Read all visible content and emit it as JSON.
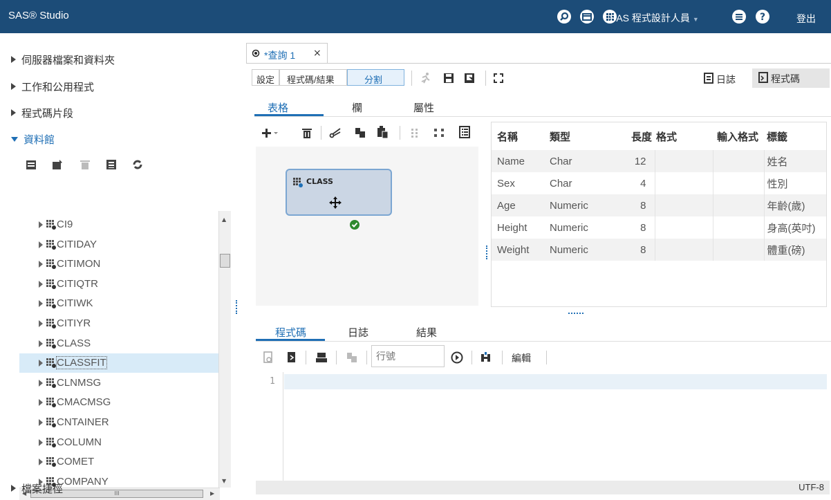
{
  "header": {
    "app_title": "SAS® Studio",
    "user_menu": "SAS 程式設計人員",
    "logout": "登出"
  },
  "nav": {
    "server_files": "伺服器檔案和資料夾",
    "tasks": "工作和公用程式",
    "snippets": "程式碼片段",
    "libraries": "資料館",
    "file_shortcuts": "檔案捷徑",
    "library_items": [
      "CI9",
      "CITIDAY",
      "CITIMON",
      "CITIQTR",
      "CITIWK",
      "CITIYR",
      "CLASS",
      "CLASSFIT",
      "CLNMSG",
      "CMACMSG",
      "CNTAINER",
      "COLUMN",
      "COMET",
      "COMPANY"
    ],
    "selected_item": "CLASSFIT",
    "hscroll_label": "III"
  },
  "query_tab": {
    "label": "*查詢 1",
    "close": "×"
  },
  "toolbar": {
    "settings": "設定",
    "code_results": "程式碼/結果",
    "split": "分割",
    "log": "日誌",
    "code": "程式碼"
  },
  "subtabs": {
    "table": "表格",
    "columns": "欄",
    "properties": "屬性"
  },
  "diagram": {
    "node_label": "CLASS"
  },
  "columns_table": {
    "headers": [
      "名稱",
      "類型",
      "長度",
      "格式",
      "輸入格式",
      "標籤"
    ],
    "rows": [
      {
        "name": "Name",
        "type": "Char",
        "length": "12",
        "format": "",
        "informat": "",
        "label": "姓名"
      },
      {
        "name": "Sex",
        "type": "Char",
        "length": "4",
        "format": "",
        "informat": "",
        "label": "性別"
      },
      {
        "name": "Age",
        "type": "Numeric",
        "length": "8",
        "format": "",
        "informat": "",
        "label": "年齡(歲)"
      },
      {
        "name": "Height",
        "type": "Numeric",
        "length": "8",
        "format": "",
        "informat": "",
        "label": "身高(英吋)"
      },
      {
        "name": "Weight",
        "type": "Numeric",
        "length": "8",
        "format": "",
        "informat": "",
        "label": "體重(磅)"
      }
    ]
  },
  "bottom": {
    "tab_code": "程式碼",
    "tab_log": "日誌",
    "tab_results": "結果",
    "line_placeholder": "行號",
    "edit": "編輯",
    "line_number": "1",
    "encoding": "UTF-8"
  },
  "colors": {
    "header_bg": "#1c4c78",
    "accent": "#1f6fb5",
    "selection": "#d8ebf8"
  }
}
